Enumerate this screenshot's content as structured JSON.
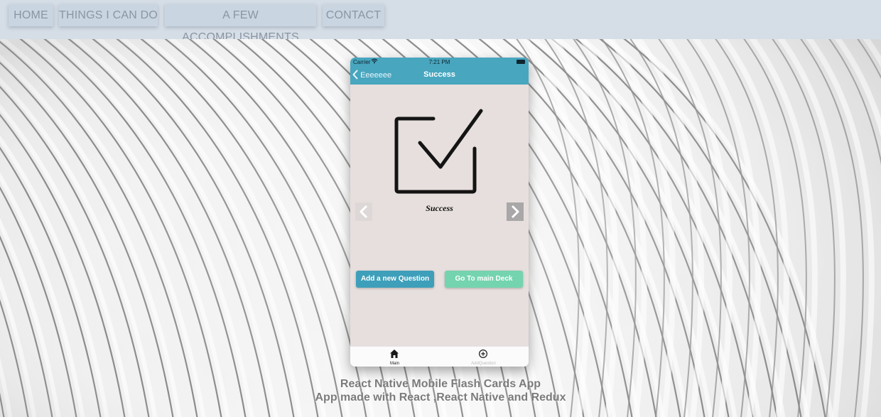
{
  "nav": {
    "items": [
      {
        "label": "HOME"
      },
      {
        "label": "THINGS I CAN DO"
      },
      {
        "label": "A FEW ACCOMPLISHMENTS"
      },
      {
        "label": "CONTACT"
      }
    ]
  },
  "phone": {
    "status": {
      "carrier": "Carrier",
      "time": "7:21 PM"
    },
    "header": {
      "back_label": "Eeeeeee",
      "title": "Success"
    },
    "content": {
      "icon": "checkbox-checked-icon",
      "caption": "Success",
      "prev_icon": "chevron-left-icon",
      "next_icon": "chevron-right-icon"
    },
    "buttons": {
      "add_question": "Add a new Question",
      "main_deck": "Go To main Deck"
    },
    "tabs": [
      {
        "label": "Main",
        "icon": "home-icon",
        "active": true
      },
      {
        "label": "AddQuestion",
        "icon": "plus-circle-icon",
        "active": false
      }
    ]
  },
  "caption": {
    "title": "React Native Mobile Flash Cards App",
    "subtitle": "App made with React ,React Native and Redux"
  },
  "colors": {
    "phone_header": "#48a6bf",
    "add_button": "#3e9fba",
    "main_deck_button": "#74d4b0",
    "nav_button": "#c9d5e1",
    "nav_text": "#8a96a3"
  }
}
